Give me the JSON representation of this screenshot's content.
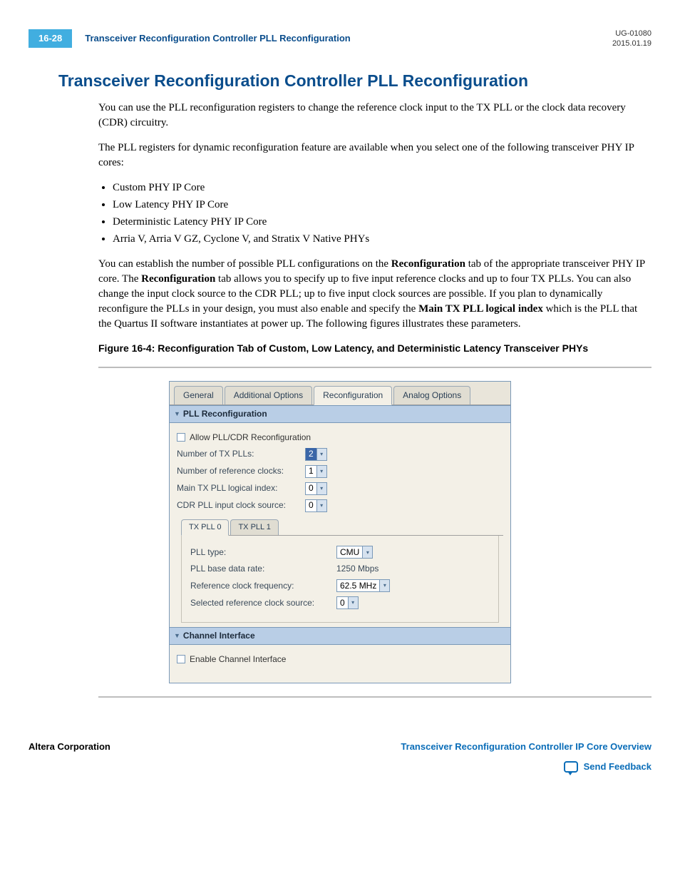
{
  "header": {
    "page_num": "16-28",
    "title": "Transceiver Reconfiguration Controller PLL Reconfiguration",
    "doc_id": "UG-01080",
    "date": "2015.01.19"
  },
  "section_title": "Transceiver Reconfiguration Controller PLL Reconfiguration",
  "p1": "You can use the PLL reconfiguration registers to change the reference clock input to the TX PLL or the clock data recovery (CDR) circuitry.",
  "p2": "The PLL registers for dynamic reconfiguration feature are available when you select one of the following transceiver PHY IP cores:",
  "list": [
    "Custom PHY IP Core",
    "Low Latency PHY IP Core",
    "Deterministic Latency PHY IP Core",
    "Arria V, Arria V GZ, Cyclone V, and Stratix V Native PHYs"
  ],
  "p3a": "You can establish the number of possible PLL configurations on the ",
  "p3b": "Reconfiguration",
  "p3c": " tab of the appropriate transceiver PHY IP core. The ",
  "p3d": "Reconfiguration",
  "p3e": " tab allows you to specify up to five input reference clocks and up to four TX PLLs. You can also change the input clock source to the CDR PLL; up to five input clock sources are possible. If you plan to dynamically reconfigure the PLLs in your design, you must also enable ",
  "p3f": " and specify the ",
  "p3g": "Main TX PLL logical index",
  "p3h": " which is the PLL that the Quartus II software instantiates at power up. The following figures illustrates these parameters.",
  "figure_caption": "Figure 16-4: Reconfiguration Tab of Custom, Low Latency, and Deterministic Latency Transceiver PHYs",
  "ui": {
    "tabs": [
      "General",
      "Additional Options",
      "Reconfiguration",
      "Analog Options"
    ],
    "section1_head": "PLL Reconfiguration",
    "allow_label": "Allow PLL/CDR Reconfiguration",
    "num_tx_plls_label": "Number of TX PLLs:",
    "num_tx_plls_value": "2",
    "num_ref_clocks_label": "Number of reference clocks:",
    "num_ref_clocks_value": "1",
    "main_idx_label": "Main TX PLL logical index:",
    "main_idx_value": "0",
    "cdr_src_label": "CDR PLL input clock source:",
    "cdr_src_value": "0",
    "inner_tabs": [
      "TX PLL 0",
      "TX PLL 1"
    ],
    "pll_type_label": "PLL type:",
    "pll_type_value": "CMU",
    "pll_base_label": "PLL base data rate:",
    "pll_base_value": "1250 Mbps",
    "ref_freq_label": "Reference clock frequency:",
    "ref_freq_value": "62.5 MHz",
    "sel_ref_label": "Selected reference clock source:",
    "sel_ref_value": "0",
    "section2_head": "Channel Interface",
    "enable_ch_label": "Enable Channel Interface"
  },
  "footer": {
    "left": "Altera Corporation",
    "right": "Transceiver Reconfiguration Controller IP Core Overview",
    "feedback": "Send Feedback"
  }
}
